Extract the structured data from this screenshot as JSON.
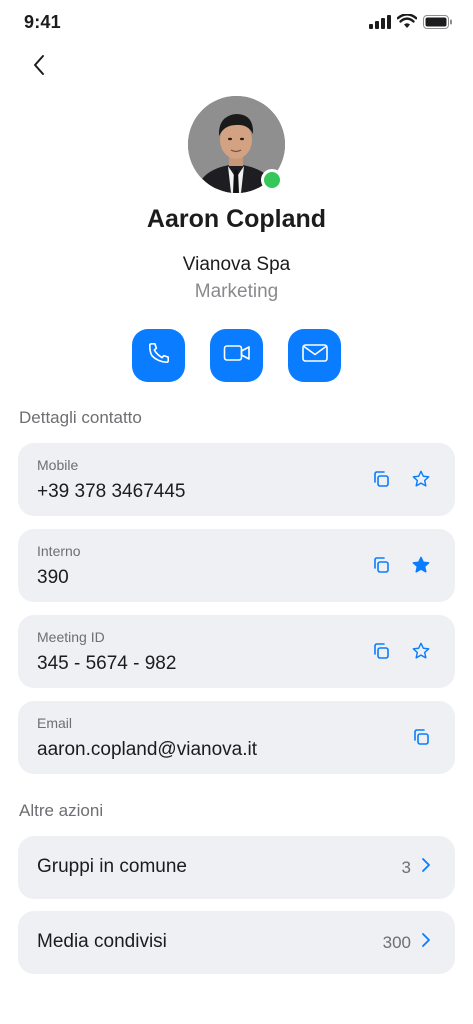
{
  "status_bar": {
    "time": "9:41"
  },
  "contact": {
    "name": "Aaron Copland",
    "company": "Vianova Spa",
    "department": "Marketing",
    "presence_color": "#34c759"
  },
  "actions": [
    {
      "icon": "phone-icon"
    },
    {
      "icon": "video-icon"
    },
    {
      "icon": "mail-icon"
    }
  ],
  "details": {
    "title": "Dettagli contatto",
    "items": [
      {
        "label": "Mobile",
        "value": "+39 378 3467445",
        "favorite": false
      },
      {
        "label": "Interno",
        "value": "390",
        "favorite": true
      },
      {
        "label": "Meeting ID",
        "value": "345 - 5674 - 982",
        "favorite": false
      },
      {
        "label": "Email",
        "value": "aaron.copland@vianova.it"
      }
    ]
  },
  "other": {
    "title": "Altre azioni",
    "items": [
      {
        "label": "Gruppi in comune",
        "count": "3"
      },
      {
        "label": "Media condivisi",
        "count": "300"
      }
    ]
  },
  "colors": {
    "accent": "#0a7cff",
    "card_bg": "#eef0f4"
  }
}
